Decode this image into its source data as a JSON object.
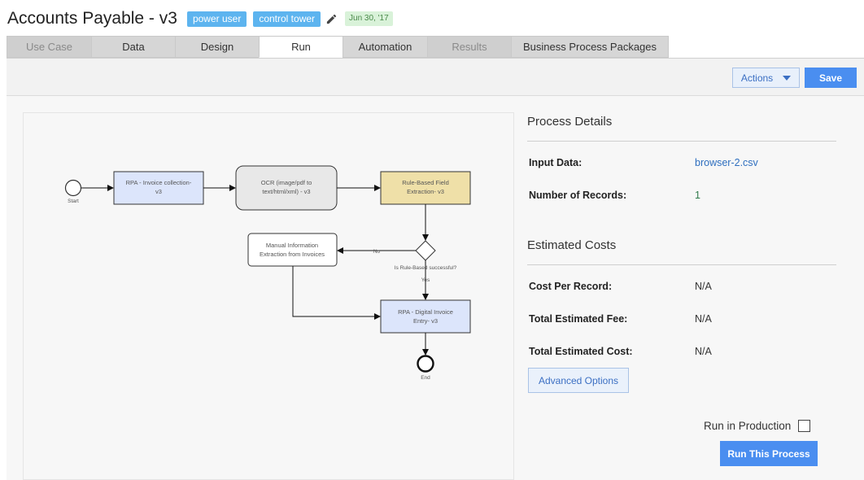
{
  "header": {
    "title": "Accounts Payable - v3",
    "tags": [
      "power user",
      "control tower"
    ],
    "date": "Jun 30, '17"
  },
  "tabs": [
    {
      "label": "Use Case",
      "state": "disabled"
    },
    {
      "label": "Data",
      "state": "normal"
    },
    {
      "label": "Design",
      "state": "normal"
    },
    {
      "label": "Run",
      "state": "active"
    },
    {
      "label": "Automation",
      "state": "normal"
    },
    {
      "label": "Results",
      "state": "disabled"
    },
    {
      "label": "Business Process Packages",
      "state": "normal"
    }
  ],
  "toolbar": {
    "actions_label": "Actions",
    "save_label": "Save"
  },
  "diagram": {
    "start_label": "Start",
    "end_label": "End",
    "nodes": {
      "invoice_collection": [
        "RPA - Invoice collection-",
        "v3"
      ],
      "ocr": [
        "OCR (image/pdf to",
        "text/html/xml) - v3"
      ],
      "rule_based": [
        "Rule-Based Field",
        "Extraction- v3"
      ],
      "manual": [
        "Manual Information",
        "Extraction from Invoices"
      ],
      "digital_entry": [
        "RPA - Digital Invoice",
        "Entry- v3"
      ]
    },
    "decision_label": "Is Rule-Based successful?",
    "no_label": "No",
    "yes_label": "Yes"
  },
  "process_details": {
    "title": "Process Details",
    "input_data_label": "Input Data:",
    "input_data_value": "browser-2.csv",
    "records_label": "Number of Records:",
    "records_value": "1"
  },
  "estimated_costs": {
    "title": "Estimated Costs",
    "cost_per_record_label": "Cost Per Record:",
    "cost_per_record_value": "N/A",
    "total_fee_label": "Total Estimated Fee:",
    "total_fee_value": "N/A",
    "total_cost_label": "Total Estimated Cost:",
    "total_cost_value": "N/A"
  },
  "advanced_options_label": "Advanced Options",
  "run_in_production_label": "Run in Production",
  "run_process_label": "Run This Process",
  "colors": {
    "tag": "#5db4ef",
    "primary": "#4a8ef0",
    "rpa_node": "#dce5fb",
    "ocr_node": "#e8e8e8",
    "rule_node": "#efe0a8"
  }
}
